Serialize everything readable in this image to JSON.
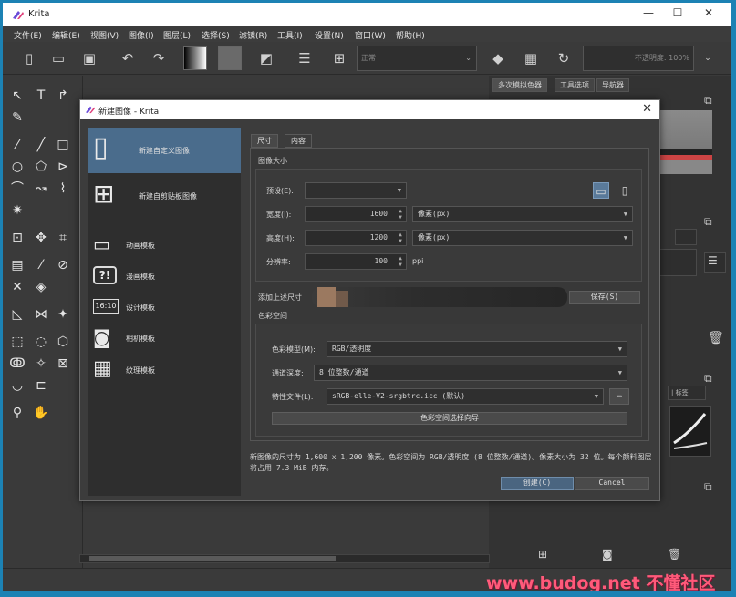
{
  "app": {
    "title": "Krita",
    "window_controls": {
      "minimize": "—",
      "maximize": "☐",
      "close": "✕"
    },
    "menu": [
      "文件(E)",
      "编辑(E)",
      "视图(V)",
      "图像(I)",
      "图层(L)",
      "选择(S)",
      "滤镜(R)",
      "工具(I)",
      "设置(N)",
      "窗口(W)",
      "帮助(H)"
    ]
  },
  "toolbar": {
    "blend_mode": "正常",
    "opacity": "不透明度: 100%"
  },
  "dockers": {
    "tabs": [
      "多次模拟色器",
      "工具选项",
      "导航器"
    ],
    "search_placeholder": "| 标签"
  },
  "dialog": {
    "title": "新建图像 - Krita",
    "templates": [
      {
        "label": "新建自定义图像",
        "icon": "blank-page-icon",
        "glyph": "▯",
        "selected": true
      },
      {
        "label": "新建自剪贴板图像",
        "icon": "clipboard-page-icon",
        "glyph": "⊞",
        "selected": false
      },
      {
        "label": "动画模板",
        "icon": "animation-template-icon",
        "glyph": "▭",
        "selected": false
      },
      {
        "label": "漫画模板",
        "icon": "comic-template-icon",
        "glyph": "?!",
        "selected": false
      },
      {
        "label": "设计模板",
        "icon": "design-template-icon",
        "glyph": "16:10",
        "selected": false
      },
      {
        "label": "相机模板",
        "icon": "camera-template-icon",
        "glyph": "◙",
        "selected": false
      },
      {
        "label": "纹理模板",
        "icon": "texture-template-icon",
        "glyph": "▦",
        "selected": false
      }
    ],
    "tabs": [
      "尺寸",
      "内容"
    ],
    "image_size": {
      "heading": "图像大小",
      "preset_label": "预设(E):",
      "preset_value": "",
      "width_label": "宽度(I):",
      "width_value": "1600",
      "width_unit": "像素(px)",
      "height_label": "高度(H):",
      "height_value": "1200",
      "height_unit": "像素(px)",
      "resolution_label": "分辨率:",
      "resolution_value": "100",
      "resolution_unit": "ppi"
    },
    "add_preset_label": "添加上述尺寸",
    "save_button": "保存(S)",
    "color_space": {
      "heading": "色彩空间",
      "model_label": "色彩模型(M):",
      "model_value": "RGB/透明度",
      "depth_label": "通道深度:",
      "depth_value": "8 位整数/通道",
      "profile_label": "特性文件(L):",
      "profile_value": "sRGB-elle-V2-srgbtrc.icc (默认)",
      "wizard_button": "色彩空间选择向导"
    },
    "info_text": "新图像的尺寸为 1,600 x 1,200 像素。色彩空间为 RGB/透明度 (8 位整数/通道)。像素大小为 32 位。每个颜料图层将占用 7.3 MiB 内存。",
    "create_button": "创建(C)",
    "cancel_button": "Cancel"
  },
  "watermark": "www.budog.net 不懂社区"
}
